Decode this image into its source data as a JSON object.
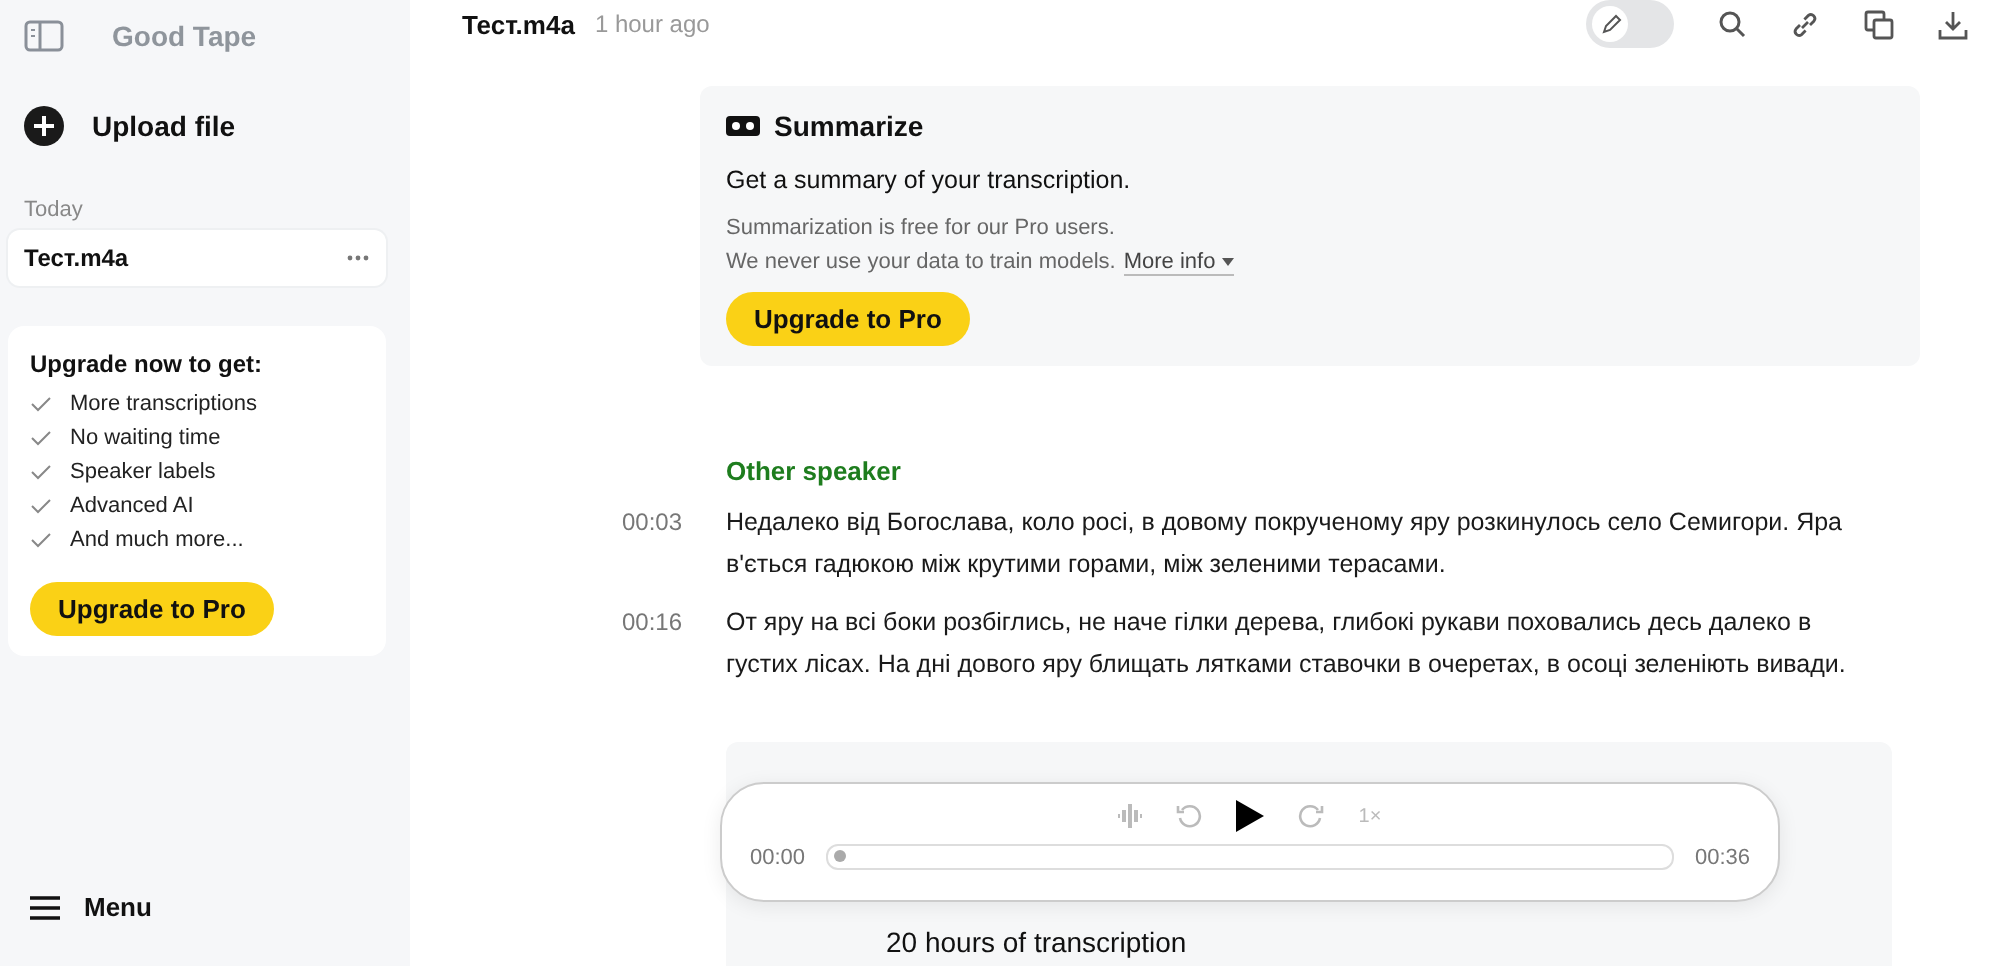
{
  "sidebar": {
    "brand": "Good Tape",
    "upload": "Upload file",
    "section": "Today",
    "files": [
      {
        "name": "Тест.m4a",
        "selected": true
      }
    ],
    "upgrade": {
      "title": "Upgrade now to get:",
      "features": [
        "More transcriptions",
        "No waiting time",
        "Speaker labels",
        "Advanced AI",
        "And much more..."
      ],
      "button": "Upgrade to Pro"
    },
    "menu": "Menu"
  },
  "header": {
    "title": "Тест.m4a",
    "time": "1 hour ago",
    "edit_toggle": {
      "on": false
    }
  },
  "summarize": {
    "title": "Summarize",
    "lead": "Get a summary of your transcription.",
    "note_1": "Summarization is free for our Pro users.",
    "note_2": "We never use your data to train models.",
    "more_info": "More info",
    "button": "Upgrade to Pro"
  },
  "transcript": {
    "speaker": "Other speaker",
    "segments": [
      {
        "time": "00:03",
        "text": "Недалеко від Богослава, коло росі, в довому покрученому яру розкинулось село Семигори. Яра в'ється гадюкою між крутими горами, між зеленими терасами."
      },
      {
        "time": "00:16",
        "text": "От яру на всі боки розбіглись, не наче гілки дерева, глибокі рукави поховались десь далеко в густих лісах. На дні дового яру блищать лятками ставочки в очеретах, в осоці зеленіють вивади."
      }
    ]
  },
  "promo": {
    "text": "20 hours of transcription"
  },
  "player": {
    "speed": "1×",
    "current": "00:00",
    "duration": "00:36",
    "level": 0
  }
}
